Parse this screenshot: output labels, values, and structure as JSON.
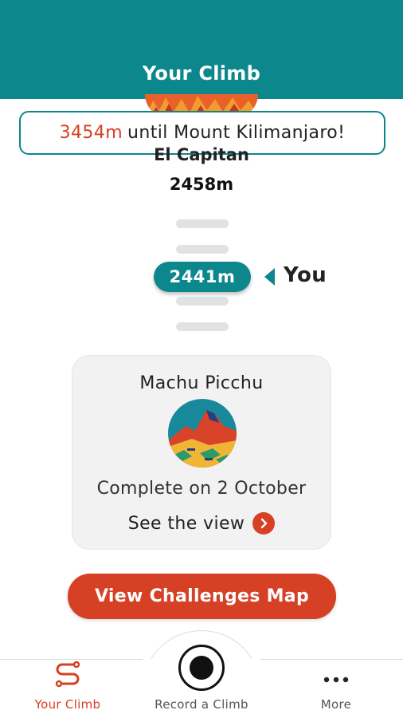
{
  "header": {
    "title": "Your Climb"
  },
  "banner": {
    "distance": "3454m",
    "text": "until Mount Kilimanjaro!"
  },
  "current_peak": {
    "name": "El Capitan",
    "altitude": "2458m"
  },
  "progress": {
    "altitude": "2441m",
    "you_label": "You"
  },
  "milestone_card": {
    "title": "Machu Picchu",
    "image_icon": "machu-picchu-illustration",
    "completed": "Complete on 2 October",
    "link_label": "See the view"
  },
  "cta": {
    "label": "View Challenges Map"
  },
  "bottom_nav": {
    "items": [
      {
        "label": "Your Climb",
        "icon": "route-icon",
        "active": true
      },
      {
        "label": "Record a Climb",
        "icon": "record-icon",
        "active": false
      },
      {
        "label": "More",
        "icon": "more-dots-icon",
        "active": false
      }
    ]
  },
  "colors": {
    "teal": "#0c878c",
    "accent": "#d64025",
    "card_bg": "#f2f2f2"
  }
}
